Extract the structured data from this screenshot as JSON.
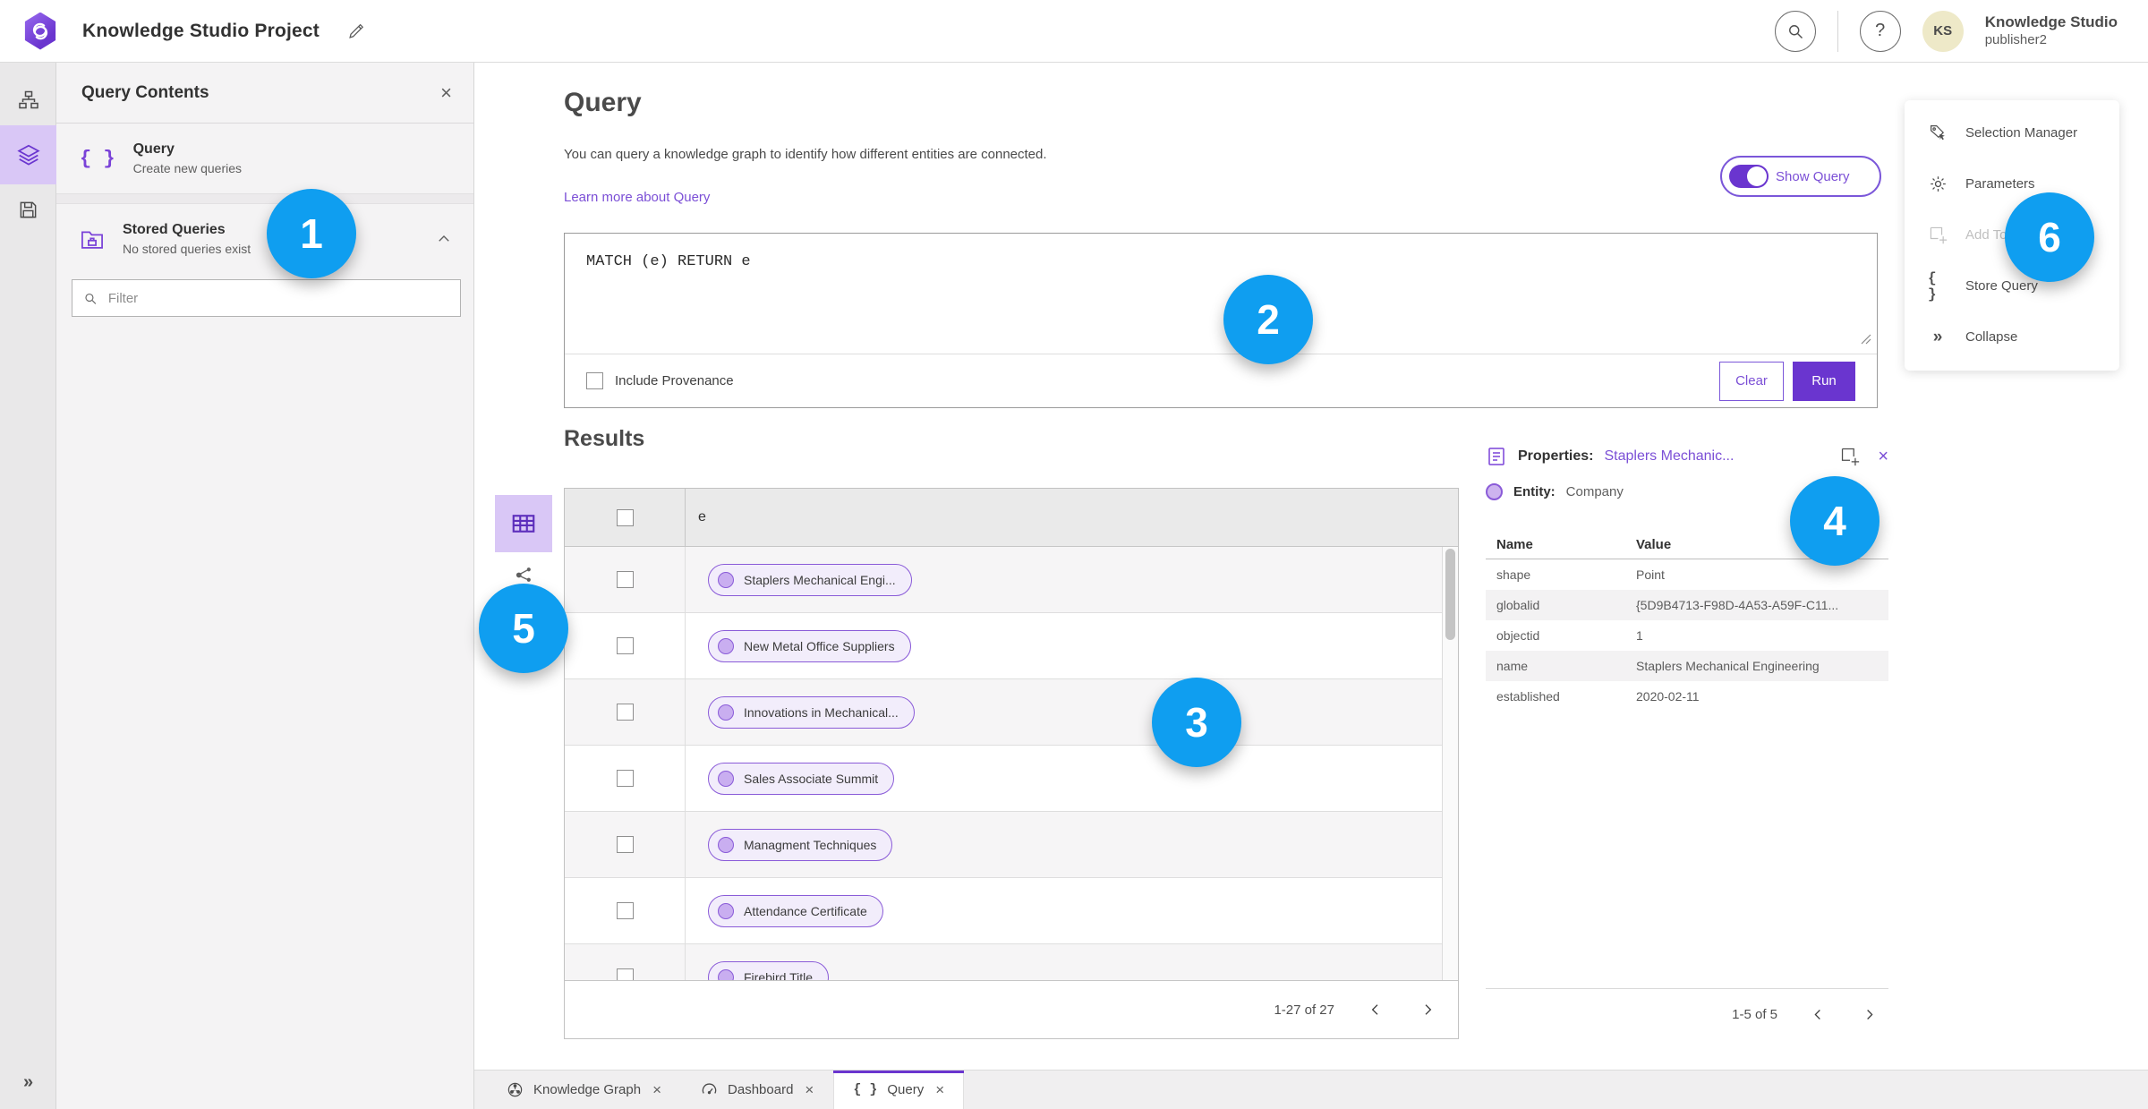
{
  "header": {
    "title": "Knowledge Studio Project",
    "user": {
      "initials": "KS",
      "org": "Knowledge Studio",
      "username": "publisher2"
    }
  },
  "icons": {
    "close": "×",
    "help": "?",
    "braces": "{ }",
    "collapse": "»"
  },
  "contents_panel": {
    "title": "Query Contents",
    "query_item": {
      "title": "Query",
      "subtitle": "Create new queries"
    },
    "stored_queries": {
      "title": "Stored Queries",
      "subtitle": "No stored queries exist"
    },
    "filter_placeholder": "Filter"
  },
  "query_section": {
    "title": "Query",
    "description": "You can query a knowledge graph to identify how different entities are connected.",
    "learn_more": "Learn more about Query",
    "show_query_label": "Show Query",
    "query_text": "MATCH (e) RETURN e",
    "include_provenance_label": "Include Provenance",
    "clear_label": "Clear",
    "run_label": "Run"
  },
  "results": {
    "title": "Results",
    "column_header": "e",
    "rows": [
      "Staplers Mechanical Engi...",
      "New Metal Office Suppliers",
      "Innovations in Mechanical...",
      "Sales Associate Summit",
      "Managment Techniques",
      "Attendance Certificate",
      "Firebird Title"
    ],
    "pagination": "1-27 of 27"
  },
  "properties_panel": {
    "title_label": "Properties:",
    "title_link": "Staplers Mechanic...",
    "entity_label": "Entity:",
    "entity_value": "Company",
    "table": {
      "headers": [
        "Name",
        "Value"
      ],
      "rows": [
        [
          "shape",
          "Point"
        ],
        [
          "globalid",
          "{5D9B4713-F98D-4A53-A59F-C11..."
        ],
        [
          "objectid",
          "1"
        ],
        [
          "name",
          "Staplers Mechanical Engineering"
        ],
        [
          "established",
          "2020-02-11"
        ]
      ]
    },
    "pagination": "1-5 of 5"
  },
  "tools_menu": {
    "items": [
      {
        "label": "Selection Manager"
      },
      {
        "label": "Parameters"
      },
      {
        "label": "Add To Selection",
        "disabled": true
      },
      {
        "label": "Store Query"
      },
      {
        "label": "Collapse"
      }
    ]
  },
  "bottom_tabs": [
    {
      "label": "Knowledge Graph"
    },
    {
      "label": "Dashboard"
    },
    {
      "label": "Query",
      "active": true
    }
  ],
  "annotations": [
    {
      "label": "1"
    },
    {
      "label": "2"
    },
    {
      "label": "3"
    },
    {
      "label": "4"
    },
    {
      "label": "5"
    },
    {
      "label": "6"
    }
  ],
  "colors": {
    "accent_purple": "#6a35cf",
    "link_purple": "#7b4fd6",
    "chip_border_purple": "#8a5bd8",
    "annotation_blue": "#0f9ef0",
    "avatar_yellow": "#eee9c8"
  }
}
